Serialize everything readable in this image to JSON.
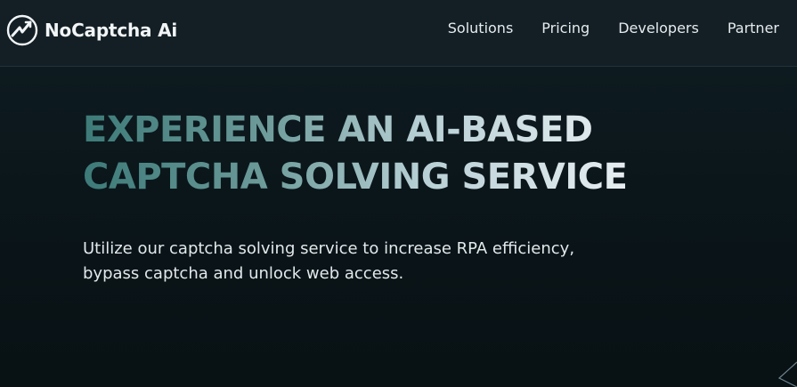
{
  "brand": {
    "name": "NoCaptcha Ai",
    "logo_icon": "lightning-circle-icon"
  },
  "nav": {
    "items": [
      "Solutions",
      "Pricing",
      "Developers",
      "Partner"
    ]
  },
  "hero": {
    "headline_line1": "EXPERIENCE AN AI-BASED",
    "headline_line2": "CAPTCHA SOLVING SERVICE",
    "subtext_line1": "Utilize our captcha solving service to increase RPA efficiency,",
    "subtext_line2": "bypass captcha and unlock web access."
  },
  "colors": {
    "background": "#0b1519",
    "header_background": "#131f25",
    "headline_gradient_start": "#3c7a78",
    "headline_gradient_end": "#e7eef2",
    "text": "#e6ecef"
  }
}
